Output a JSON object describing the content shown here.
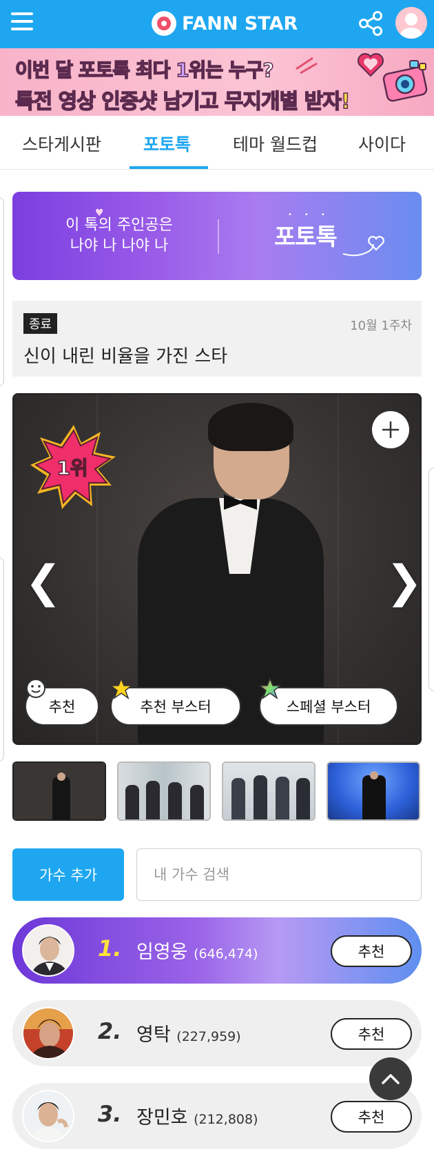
{
  "header": {
    "logo_text": "FANN STAR",
    "menu_icon": "hamburger-icon",
    "share_icon": "share-icon",
    "profile_icon": "avatar"
  },
  "promo": {
    "line1_a": "이번 달 포토톡 ",
    "line1_hl": "최다 1위",
    "line1_b": "는 누구?",
    "line2_a": "특전 영상 인증샷 남기고 ",
    "line2_hl": "무지개별 받자!"
  },
  "tabs": [
    {
      "label": "스타게시판",
      "active": false
    },
    {
      "label": "포토톡",
      "active": true
    },
    {
      "label": "테마 월드컵",
      "active": false
    },
    {
      "label": "사이다",
      "active": false
    }
  ],
  "photo_talk_banner": {
    "line1": "이 톡의 주인공은",
    "line2": "나야 나 나야 나",
    "title": "포토톡"
  },
  "status": {
    "badge": "종료",
    "week": "10월 1주차",
    "title": "신이 내린 비율을 가진 스타"
  },
  "photo": {
    "rank_badge": "1위",
    "prev_arrow": "❮",
    "next_arrow": "❯",
    "buttons": {
      "recommend": "추천",
      "recommend_booster": "추천 부스터",
      "special_booster": "스페셜 부스터"
    }
  },
  "search": {
    "add_label": "가수 추가",
    "placeholder": "내 가수 검색"
  },
  "ranking": [
    {
      "rank": "1.",
      "name": "임영웅",
      "votes": "(646,474)",
      "button": "추천"
    },
    {
      "rank": "2.",
      "name": "영탁",
      "votes": "(227,959)",
      "button": "추천"
    },
    {
      "rank": "3.",
      "name": "장민호",
      "votes": "(212,808)",
      "button": "추천"
    }
  ],
  "colors": {
    "brand": "#1ea7f0",
    "promo_pink": "#fbc4d4",
    "rank1_gradient_start": "#6d38d8",
    "rank1_gradient_end": "#5f8ff0",
    "rank_number_gold": "#ffe13b"
  }
}
